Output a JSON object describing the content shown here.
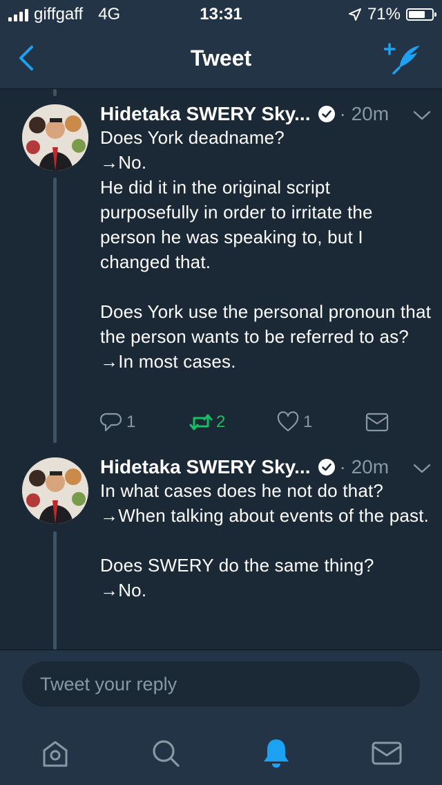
{
  "status_bar": {
    "carrier": "giffgaff",
    "network": "4G",
    "time": "13:31",
    "battery": "71%",
    "battery_level": 0.71
  },
  "nav": {
    "title": "Tweet",
    "back_icon": "chevron-left-icon",
    "compose_icon": "compose-tweet-icon"
  },
  "tweets": [
    {
      "author": "Hidetaka SWERY Sky...",
      "time": "· 20m",
      "paragraphs": [
        "Does York deadname?\n→No.\nHe did it in the original script purposefully in order to irritate the person he was speaking to, but I changed that.",
        "Does York use the personal pronoun that the person wants to be referred to as?\n→In most cases."
      ],
      "replies": "1",
      "retweets": "2",
      "likes": "1"
    },
    {
      "author": "Hidetaka SWERY Sky...",
      "time": "· 20m",
      "paragraphs": [
        "In what cases does he not do that?\n→When talking about events of the past.",
        "Does SWERY do the same thing?\n→No."
      ]
    }
  ],
  "reply": {
    "placeholder": "Tweet your reply"
  },
  "colors": {
    "background": "#1b2836",
    "bar": "#243447",
    "accent": "#1da1f2",
    "muted": "#8899a6",
    "retweet": "#17bf63"
  },
  "tabbar": [
    "home-icon",
    "search-icon",
    "notifications-icon",
    "messages-icon"
  ]
}
